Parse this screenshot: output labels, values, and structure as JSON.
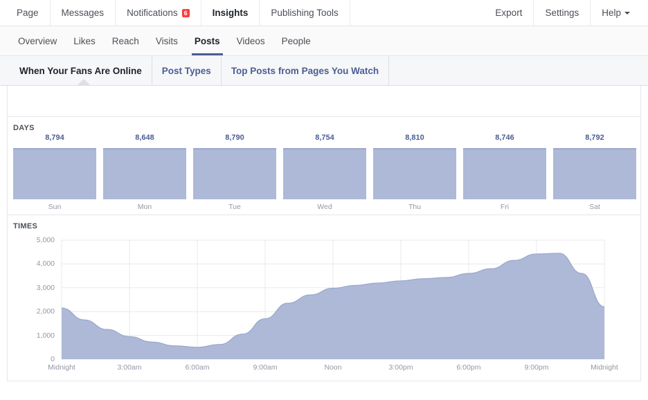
{
  "topnav": {
    "left_items": [
      {
        "label": "Page",
        "active": false
      },
      {
        "label": "Messages",
        "active": false
      },
      {
        "label": "Notifications",
        "active": false,
        "badge": "6"
      },
      {
        "label": "Insights",
        "active": true
      },
      {
        "label": "Publishing Tools",
        "active": false
      }
    ],
    "right_items": [
      {
        "label": "Export"
      },
      {
        "label": "Settings"
      },
      {
        "label": "Help",
        "caret": true
      }
    ]
  },
  "subnav": {
    "items": [
      {
        "label": "Overview",
        "active": false
      },
      {
        "label": "Likes",
        "active": false
      },
      {
        "label": "Reach",
        "active": false
      },
      {
        "label": "Visits",
        "active": false
      },
      {
        "label": "Posts",
        "active": true
      },
      {
        "label": "Videos",
        "active": false
      },
      {
        "label": "People",
        "active": false
      }
    ]
  },
  "tabs": {
    "items": [
      {
        "label": "When Your Fans Are Online",
        "active": true
      },
      {
        "label": "Post Types",
        "active": false
      },
      {
        "label": "Top Posts from Pages You Watch",
        "active": false
      }
    ]
  },
  "sections": {
    "days_label": "DAYS",
    "times_label": "TIMES"
  },
  "colors": {
    "series_fill": "#aeb9d7",
    "series_stroke": "#9aa7cb",
    "accent": "#4b5d94",
    "badge": "#fa3e3e",
    "grid": "#e8e9ed",
    "muted_text": "#9197a3"
  },
  "chart_data": [
    {
      "type": "bar",
      "title": "DAYS",
      "xlabel": "",
      "ylabel": "",
      "categories": [
        "Sun",
        "Mon",
        "Tue",
        "Wed",
        "Thu",
        "Fri",
        "Sat"
      ],
      "values": [
        8794,
        8648,
        8790,
        8754,
        8810,
        8746,
        8792
      ],
      "value_labels": [
        "8,794",
        "8,648",
        "8,790",
        "8,754",
        "8,810",
        "8,746",
        "8,792"
      ],
      "grid": false,
      "legend": "none"
    },
    {
      "type": "area",
      "title": "TIMES",
      "xlabel": "",
      "ylabel": "",
      "ylim": [
        0,
        5000
      ],
      "yticks": [
        0,
        1000,
        2000,
        3000,
        4000,
        5000
      ],
      "ytick_labels": [
        "0",
        "1,000",
        "2,000",
        "3,000",
        "4,000",
        "5,000"
      ],
      "xticks": [
        0,
        3,
        6,
        9,
        12,
        15,
        18,
        21,
        24
      ],
      "xtick_labels": [
        "Midnight",
        "3:00am",
        "6:00am",
        "9:00am",
        "Noon",
        "3:00pm",
        "6:00pm",
        "9:00pm",
        "Midnight"
      ],
      "grid": true,
      "legend": "none",
      "x": [
        0,
        1,
        2,
        3,
        4,
        5,
        6,
        7,
        8,
        9,
        10,
        11,
        12,
        13,
        14,
        15,
        16,
        17,
        18,
        19,
        20,
        21,
        22,
        23,
        24
      ],
      "values": [
        2150,
        1650,
        1250,
        950,
        720,
        560,
        500,
        620,
        1050,
        1700,
        2350,
        2700,
        2980,
        3100,
        3200,
        3290,
        3380,
        3430,
        3600,
        3800,
        4150,
        4420,
        4450,
        3600,
        2200
      ]
    }
  ]
}
